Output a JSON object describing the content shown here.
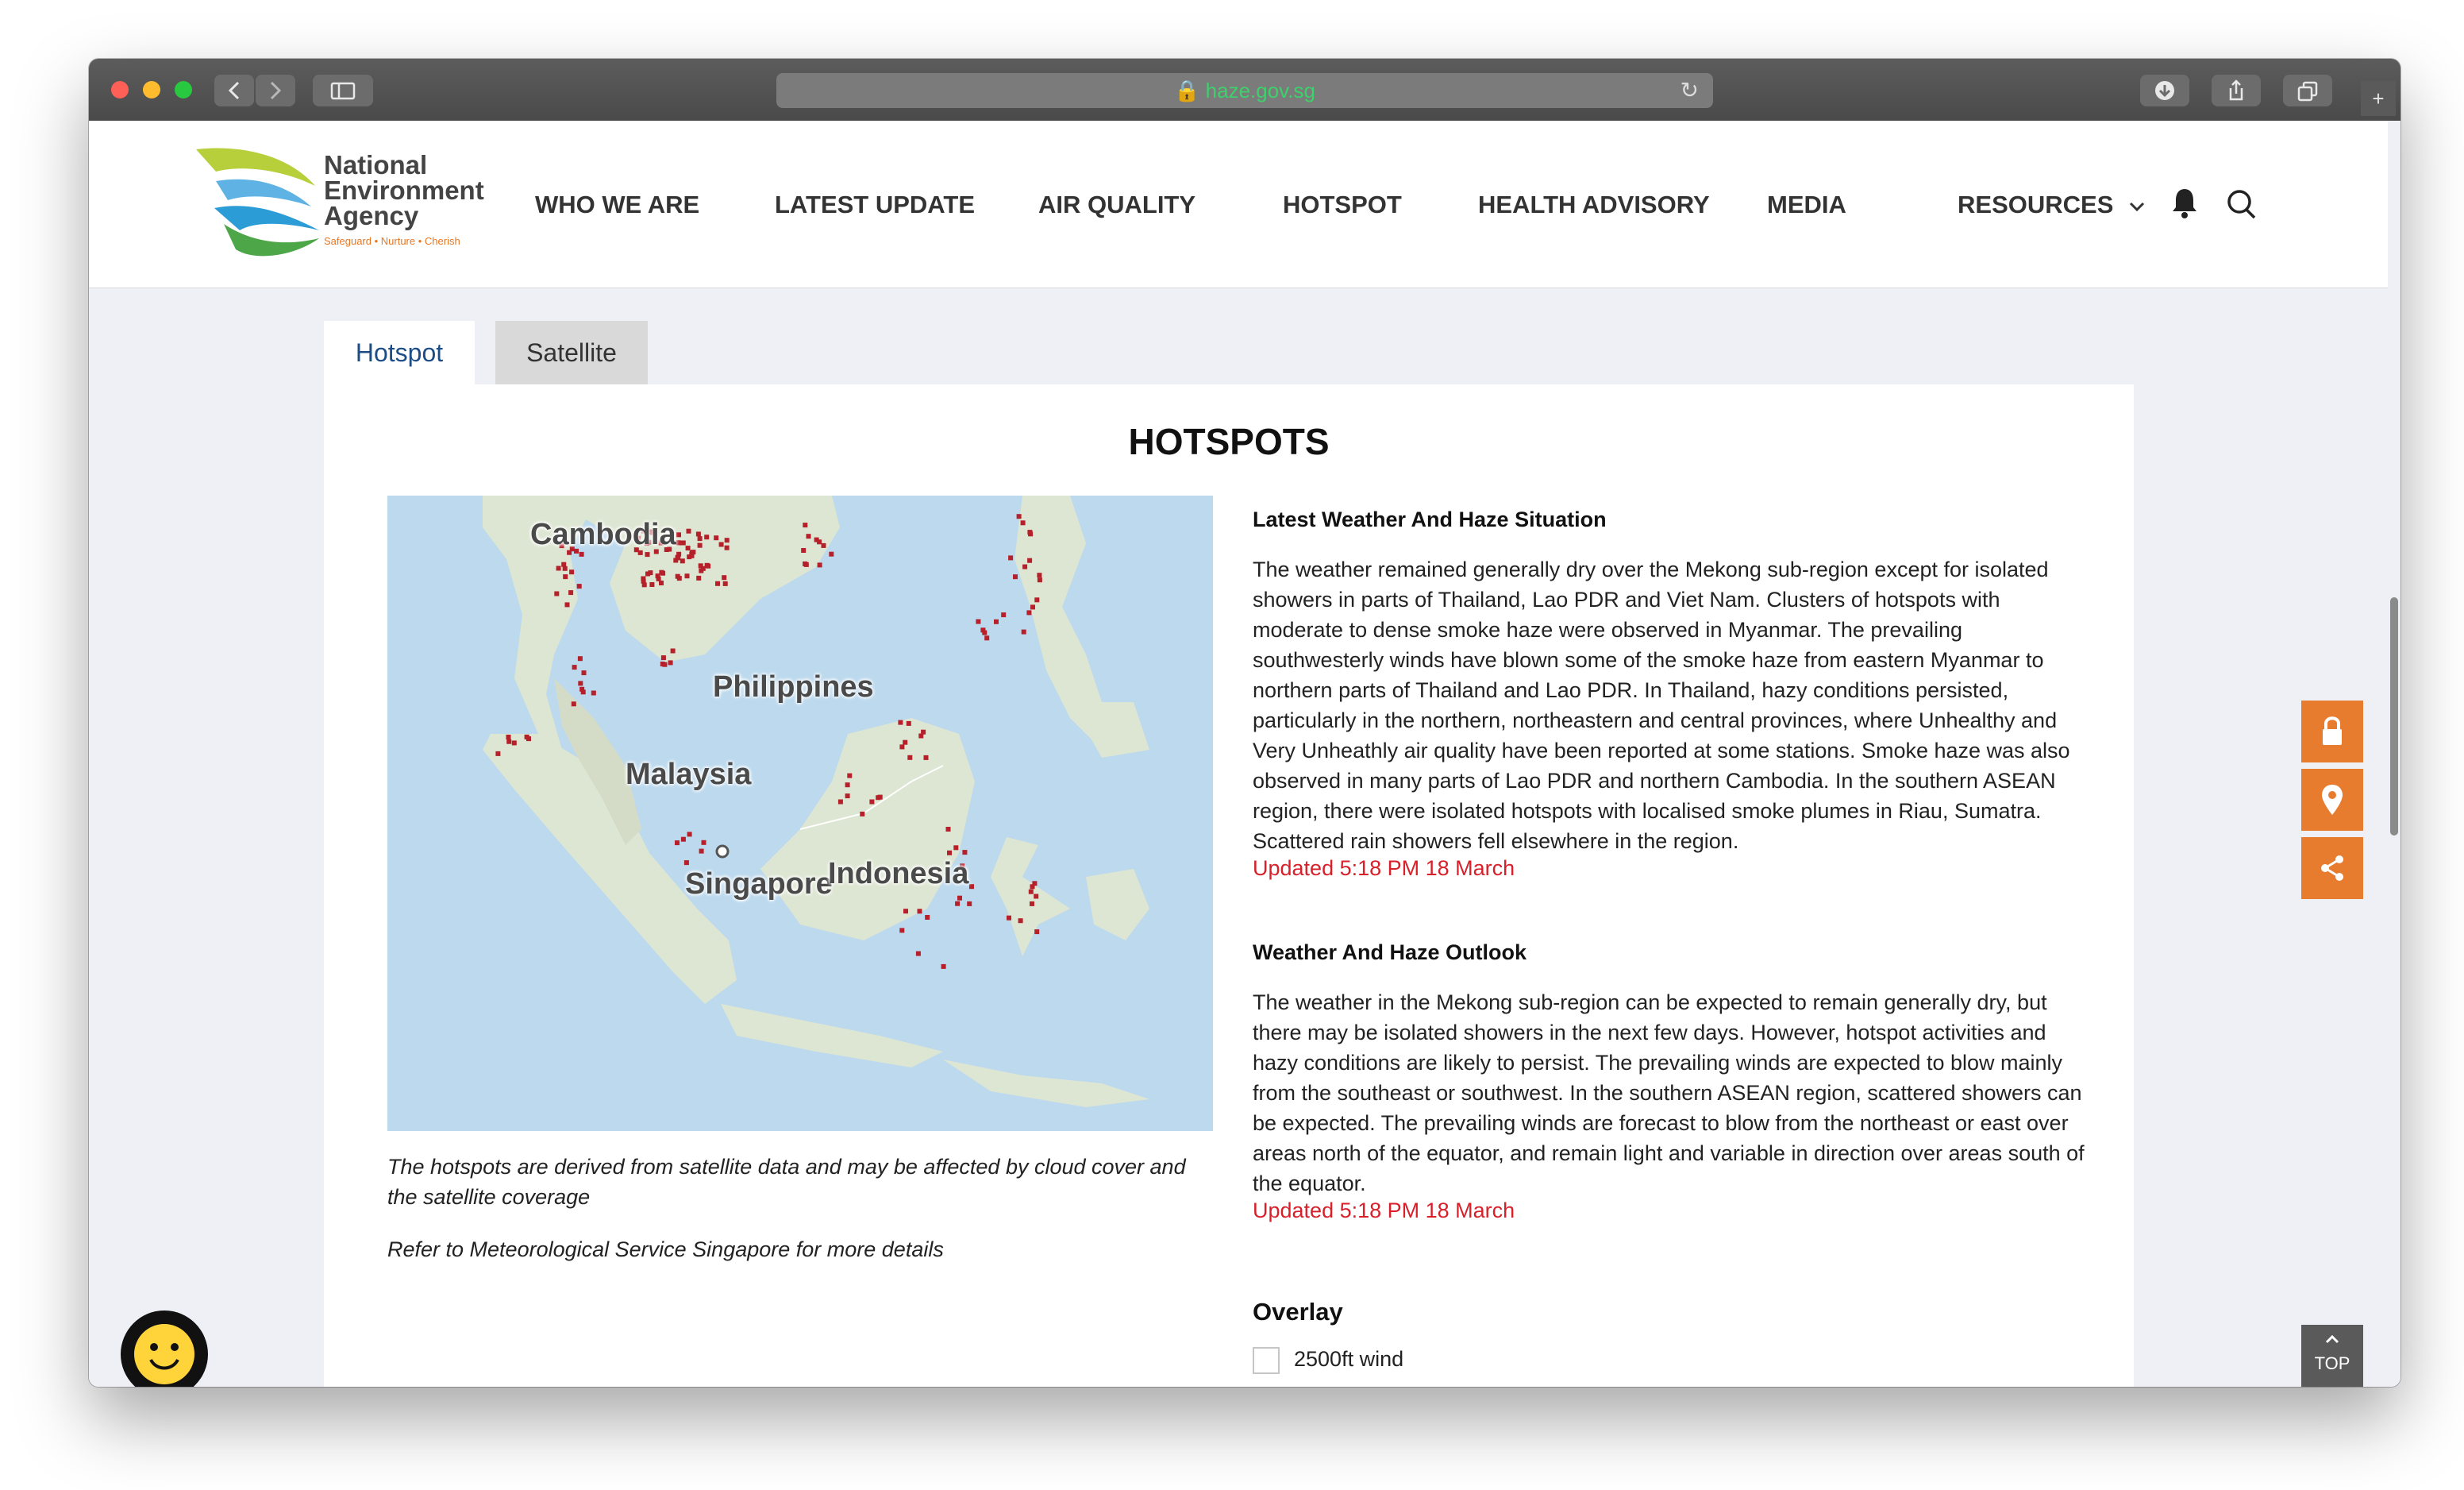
{
  "browser": {
    "url": "haze.gov.sg",
    "back_icon": "chevron-left-icon",
    "forward_icon": "chevron-right-icon",
    "sidebar_icon": "sidebar-icon",
    "reload_icon": "reload-icon",
    "download_icon": "download-icon",
    "share_icon": "share-icon",
    "tabs_icon": "tabs-icon",
    "new_tab_label": "+"
  },
  "header": {
    "logo_text": [
      "National",
      "Environment",
      "Agency"
    ],
    "logo_tagline": "Safeguard • Nurture • Cherish",
    "nav": [
      "WHO WE ARE",
      "LATEST UPDATE",
      "AIR QUALITY",
      "HOTSPOT",
      "HEALTH ADVISORY",
      "MEDIA",
      "RESOURCES"
    ],
    "icons": [
      "bell-icon",
      "search-icon"
    ]
  },
  "tabs": [
    {
      "label": "Hotspot",
      "active": true
    },
    {
      "label": "Satellite",
      "active": false
    }
  ],
  "main": {
    "title": "HOTSPOTS",
    "map": {
      "labels": [
        "Cambodia",
        "Philippines",
        "Malaysia",
        "Singapore",
        "Indonesia"
      ],
      "marker_color": "#b5202a"
    },
    "caption_1": "The hotspots are derived from satellite data and may be affected by cloud cover and the satellite coverage",
    "caption_2": "Refer to Meteorological Service Singapore for more details",
    "situation": {
      "title": "Latest Weather And Haze Situation",
      "text": "The weather remained generally dry over the Mekong sub-region except for isolated showers in parts of Thailand, Lao PDR and Viet Nam. Clusters of hotspots with moderate to dense smoke haze were observed in Myanmar. The prevailing southwesterly winds have blown some of the smoke haze from eastern Myanmar to northern parts of Thailand and Lao PDR. In Thailand, hazy conditions persisted, particularly in the northern, northeastern and central provinces, where Unhealthy and Very Unheathly air quality have been reported at some stations. Smoke haze was also observed in many parts of Lao PDR and northern Cambodia. In the southern ASEAN region, there were isolated hotspots with localised smoke plumes in Riau, Sumatra. Scattered rain showers fell elsewhere in the region.",
      "updated": "Updated 5:18 PM 18 March"
    },
    "outlook": {
      "title": "Weather And Haze Outlook",
      "text": "The weather in the Mekong sub-region can be expected to remain generally dry, but there may be isolated showers in the next few days. However, hotspot activities and hazy conditions are likely to persist. The prevailing winds are expected to blow mainly from the southeast or southwest. In the southern ASEAN region, scattered showers can be expected. The prevailing winds are forecast to blow from the northeast or east over areas north of the equator, and remain light and variable in direction over areas south of the equator.",
      "updated": "Updated 5:18 PM 18 March"
    },
    "overlay": {
      "title": "Overlay",
      "options": [
        "2500ft wind"
      ]
    }
  },
  "side_buttons": [
    "lock-icon",
    "location-pin-icon",
    "share-icon"
  ],
  "top_button": "TOP",
  "colors": {
    "accent_orange": "#e87c2e",
    "link_blue": "#1d4d86",
    "updated_red": "#d8202a"
  }
}
